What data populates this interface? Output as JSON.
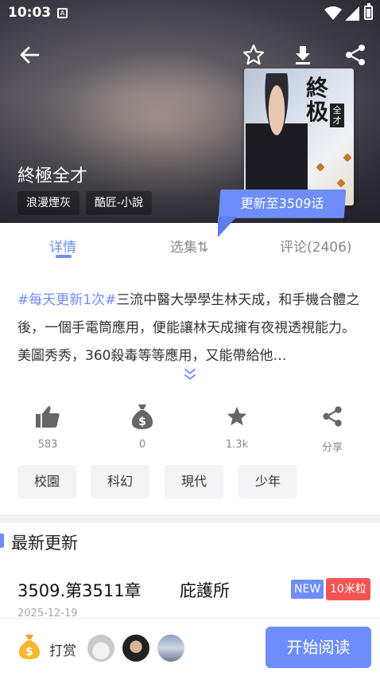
{
  "status_bar": {
    "time": "10:03",
    "notification_glyph": "A"
  },
  "header": {
    "back_icon": "arrow-left",
    "favorite_icon": "star-outline",
    "download_icon": "download",
    "share_icon": "share"
  },
  "book": {
    "title": "終極全才",
    "author_chip": "浪漫煙灰",
    "source_chip": "酷匠-小說",
    "cover_title": "終极",
    "cover_subtitle": "全才",
    "update_badge": "更新至3509话"
  },
  "tabs": [
    {
      "label": "详情",
      "active": true
    },
    {
      "label": "选集⇅",
      "active": false
    },
    {
      "label": "评论(2406)",
      "active": false
    }
  ],
  "description": {
    "hashtag": "#每天更新1次#",
    "text": "三流中醫大學學生林天成，和手機合體之後，一個手電筒應用，便能讓林天成擁有夜視透視能力。美圖秀秀，360殺毒等等應用，又能帶給他…"
  },
  "actions": [
    {
      "icon": "thumbs-up",
      "label": "583"
    },
    {
      "icon": "money-bag",
      "label": "0"
    },
    {
      "icon": "star",
      "label": "1.3k"
    },
    {
      "icon": "share",
      "label": "分享"
    }
  ],
  "tags": [
    "校園",
    "科幻",
    "現代",
    "少年"
  ],
  "latest": {
    "section_title": "最新更新",
    "chapter_number": "3509.第3511章",
    "chapter_name": "庇護所",
    "new_badge": "NEW",
    "price_badge": "10米粒",
    "date": "2025-12-19"
  },
  "bottom": {
    "tip_label": "打赏",
    "read_button": "开始阅读"
  },
  "colors": {
    "accent": "#6e8dfb",
    "price": "#f25452"
  }
}
